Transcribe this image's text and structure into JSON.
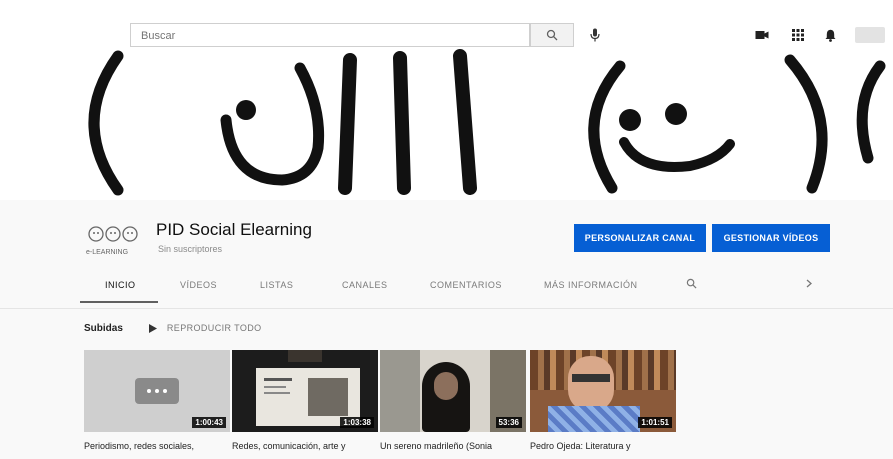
{
  "masthead": {
    "search_placeholder": "Buscar",
    "icons": [
      "search-icon",
      "microphone-icon",
      "video-camera-icon",
      "apps-grid-icon",
      "bell-icon"
    ]
  },
  "channel": {
    "title": "PID Social Elearning",
    "subscribers": "Sin suscriptores",
    "logo_text": "e-LEARNING",
    "customize_label": "PERSONALIZAR CANAL",
    "manage_label": "GESTIONAR VÍDEOS"
  },
  "tabs": [
    {
      "label": "INICIO",
      "active": true
    },
    {
      "label": "VÍDEOS"
    },
    {
      "label": "LISTAS"
    },
    {
      "label": "CANALES"
    },
    {
      "label": "COMENTARIOS"
    },
    {
      "label": "MÁS INFORMACIÓN"
    }
  ],
  "section": {
    "title": "Subidas",
    "play_all_label": "REPRODUCIR TODO"
  },
  "videos": [
    {
      "title": "Periodismo, redes sociales,",
      "duration": "1:00:43"
    },
    {
      "title": "Redes, comunicación, arte y",
      "duration": "1:03:38"
    },
    {
      "title": "Un sereno madrileño (Sonia",
      "duration": "53:36"
    },
    {
      "title": "Pedro Ojeda: Literatura y",
      "duration": "1:01:51"
    }
  ],
  "colors": {
    "accent": "#065fd4",
    "background": "#f9f9f9"
  }
}
